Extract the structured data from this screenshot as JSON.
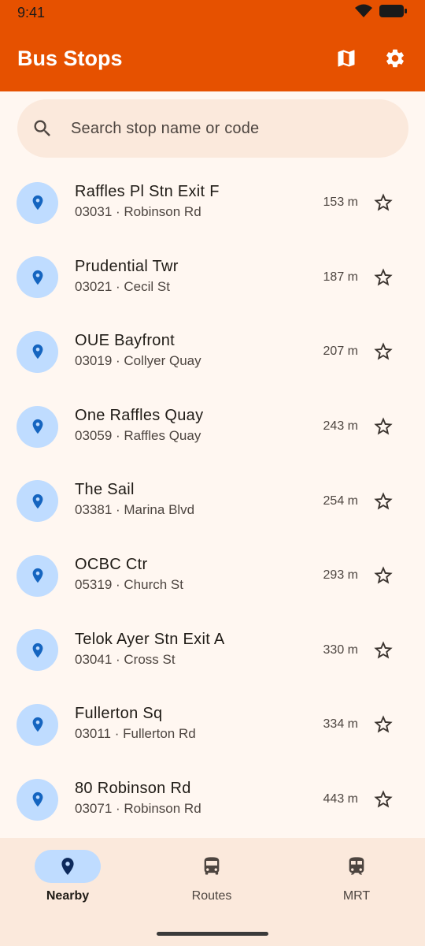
{
  "status": {
    "time": "9:41",
    "icons": [
      "wifi-icon",
      "battery-icon"
    ]
  },
  "appbar": {
    "title": "Bus Stops",
    "actions": [
      "map-icon",
      "gear-icon"
    ]
  },
  "search": {
    "placeholder": "Search stop name or code",
    "value": ""
  },
  "stops": [
    {
      "name": "Raffles Pl Stn Exit F",
      "sub": "03031 · Robinson Rd",
      "distance": "153 m"
    },
    {
      "name": "Prudential Twr",
      "sub": "03021 · Cecil St",
      "distance": "187 m"
    },
    {
      "name": "OUE Bayfront",
      "sub": "03019 · Collyer Quay",
      "distance": "207 m"
    },
    {
      "name": "One Raffles Quay",
      "sub": "03059 · Raffles Quay",
      "distance": "243 m"
    },
    {
      "name": "The Sail",
      "sub": "03381 · Marina Blvd",
      "distance": "254 m"
    },
    {
      "name": "OCBC Ctr",
      "sub": "05319 · Church St",
      "distance": "293 m"
    },
    {
      "name": "Telok Ayer Stn Exit A",
      "sub": "03041 · Cross St",
      "distance": "330 m"
    },
    {
      "name": "Fullerton Sq",
      "sub": "03011 · Fullerton Rd",
      "distance": "334 m"
    },
    {
      "name": "80 Robinson Rd",
      "sub": "03071 · Robinson Rd",
      "distance": "443 m"
    }
  ],
  "nav": [
    {
      "label": "Nearby",
      "icon": "location-pin-icon",
      "active": true
    },
    {
      "label": "Routes",
      "icon": "bus-icon",
      "active": false
    },
    {
      "label": "MRT",
      "icon": "train-icon",
      "active": false
    }
  ],
  "colors": {
    "primary": "#e65100",
    "surface": "#fff7f1",
    "container": "#fbe9dc",
    "accent": "#bfdcff",
    "pin": "#1565c0"
  }
}
